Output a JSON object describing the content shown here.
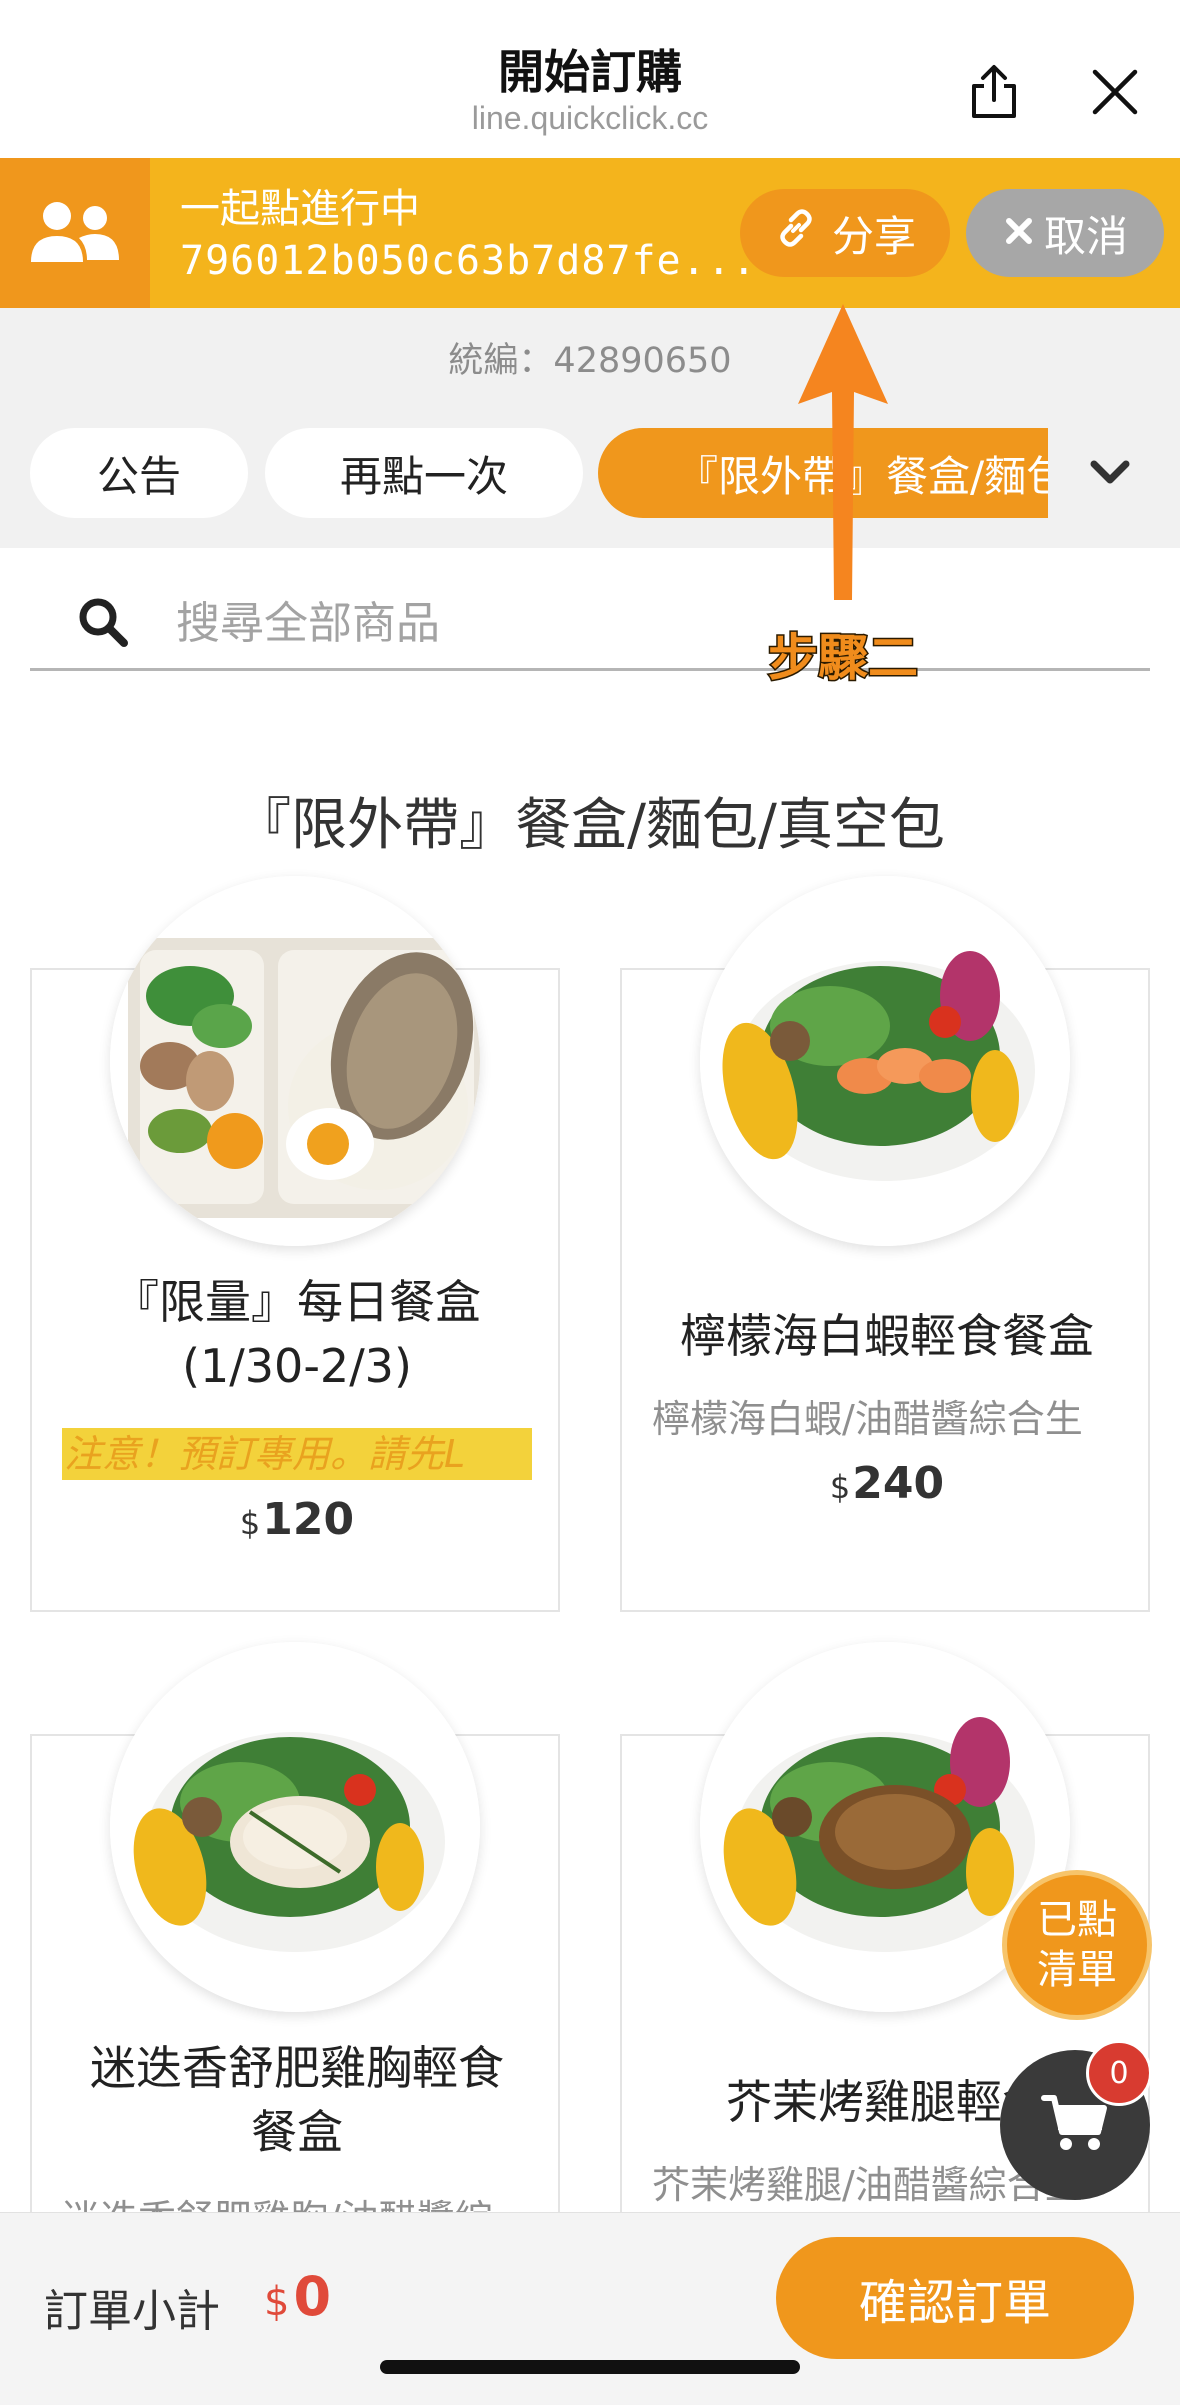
{
  "header": {
    "title": "開始訂購",
    "url": "line.quickclick.cc",
    "share_icon": "share-out-icon",
    "close_icon": "close-icon"
  },
  "banner": {
    "icon": "group-users-icon",
    "title": "一起點進行中",
    "code": "796012b050c63b7d87fe...",
    "share_label": "分享",
    "cancel_label": "取消",
    "colors": {
      "banner": "#f4b41c",
      "accent": "#f0971c",
      "cancel": "#a7a7a7"
    }
  },
  "tax_id": "統編：42890650",
  "tabs": [
    {
      "label": "公告",
      "active": false
    },
    {
      "label": "再點一次",
      "active": false
    },
    {
      "label": "『限外帶』餐盒/麵包/真空包",
      "active": true
    }
  ],
  "search": {
    "placeholder": "搜尋全部商品"
  },
  "annotation": {
    "label": "步驟二"
  },
  "section": {
    "title": "『限外帶』餐盒/麵包/真空包"
  },
  "products": [
    {
      "name_line1": "『限量』每日餐盒",
      "name_line2": "(1/30-2/3)",
      "notice": "注意！預訂專用。請先L",
      "desc": "",
      "currency": "$",
      "price": "120"
    },
    {
      "name_line1": "檸檬海白蝦輕食餐盒",
      "name_line2": "",
      "notice": "",
      "desc": "檸檬海白蝦/油醋醬綜合生",
      "currency": "$",
      "price": "240"
    },
    {
      "name_line1": "迷迭香舒肥雞胸輕食",
      "name_line2": "餐盒",
      "notice": "",
      "desc": "迷迭香舒肥雞胸/油醋醬綜",
      "currency": "$",
      "price": ""
    },
    {
      "name_line1": "芥茉烤雞腿輕食",
      "name_line2": "",
      "notice": "",
      "desc": "芥茉烤雞腿/油醋醬綜合生",
      "currency": "$",
      "price": ""
    }
  ],
  "fab": {
    "list_line1": "已點",
    "list_line2": "清單",
    "cart_count": "0"
  },
  "footer": {
    "subtotal_label": "訂單小計",
    "currency": "$",
    "subtotal_value": "0",
    "confirm_label": "確認訂單"
  }
}
